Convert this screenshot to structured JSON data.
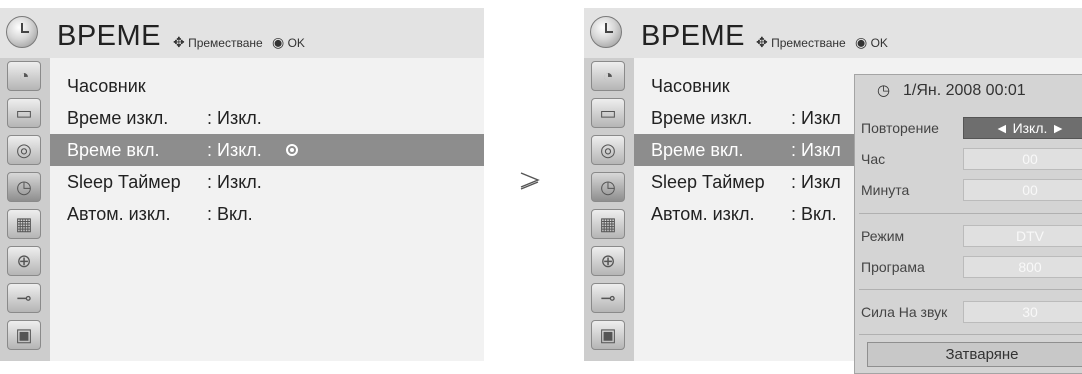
{
  "left_menu": {
    "title": "ВРЕМЕ",
    "hint_move": "Преместване",
    "hint_ok": "OK",
    "rows": [
      {
        "label": "Часовник",
        "value": ""
      },
      {
        "label": "Време изкл.",
        "value": ": Изкл."
      },
      {
        "label": "Време вкл.",
        "value": ": Изкл."
      },
      {
        "label": "Sleep Таймер",
        "value": ": Изкл."
      },
      {
        "label": "Автом. изкл.",
        "value": ": Вкл."
      }
    ]
  },
  "arrow_glyph": "≥",
  "right_menu": {
    "title": "ВРЕМЕ",
    "hint_move": "Преместване",
    "hint_ok": "OK",
    "rows": [
      {
        "label": "Часовник",
        "value": ""
      },
      {
        "label": "Време изкл.",
        "value": ": Изкл"
      },
      {
        "label": "Време вкл.",
        "value": ": Изкл"
      },
      {
        "label": "Sleep Таймер",
        "value": ": Изкл"
      },
      {
        "label": "Автом. изкл.",
        "value": ": Вкл."
      }
    ]
  },
  "popup": {
    "datetime": "1/Ян. 2008 00:01",
    "fields": [
      {
        "label": "Повторение",
        "value": "◄ Изкл. ►"
      },
      {
        "label": "Час",
        "value": "00"
      },
      {
        "label": "Минута",
        "value": "00"
      },
      {
        "label": "Режим",
        "value": "DTV"
      },
      {
        "label": "Програма",
        "value": "800"
      },
      {
        "label": "Сила На звук",
        "value": "30"
      }
    ],
    "close_label": "Затваряне"
  },
  "side_icons": [
    "satellite-dish-icon",
    "monitor-icon",
    "speaker-icon",
    "clock-icon",
    "calendar-icon",
    "lock-icon",
    "plug-icon",
    "photo-icon"
  ],
  "colors": {
    "menu_bg": "#e3e3e3",
    "selected_row": "#8d8d8d",
    "popup_bg": "#d4d4d4"
  }
}
